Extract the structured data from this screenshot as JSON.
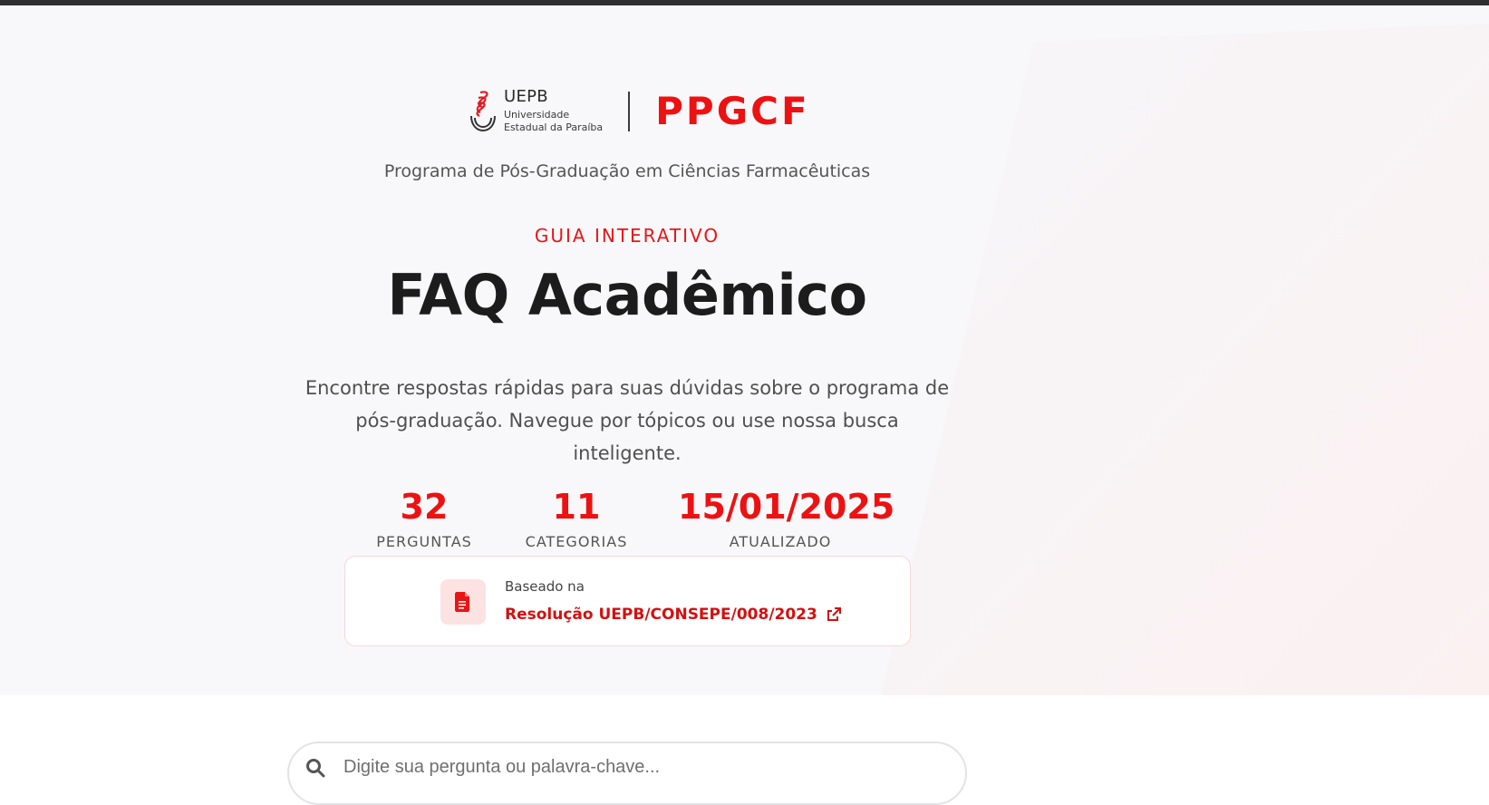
{
  "header": {
    "university_short": "UEPB",
    "university_line1": "Universidade",
    "university_line2": "Estadual da Paraíba",
    "program_acronym": "PPGCF",
    "program_name": "Programa de Pós-Graduação em Ciências Farmacêuticas"
  },
  "hero": {
    "eyebrow": "GUIA INTERATIVO",
    "title": "FAQ Acadêmico",
    "lead": "Encontre respostas rápidas para suas dúvidas sobre o programa de pós-graduação. Navegue por tópicos ou use nossa busca inteligente."
  },
  "stats": [
    {
      "value": "32",
      "label": "PERGUNTAS"
    },
    {
      "value": "11",
      "label": "CATEGORIAS"
    },
    {
      "value": "15/01/2025",
      "label": "ATUALIZADO"
    }
  ],
  "source": {
    "prefix": "Baseado na",
    "link_text": "Resolução UEPB/CONSEPE/008/2023",
    "icon": "document-icon",
    "link_icon": "external-link-icon"
  },
  "search": {
    "placeholder": "Digite sua pergunta ou palavra-chave...",
    "value": "",
    "icon": "search-icon"
  },
  "colors": {
    "accent": "#ee1111",
    "hero_bg": "#f8f8fb",
    "topbar": "#2f2f31"
  }
}
